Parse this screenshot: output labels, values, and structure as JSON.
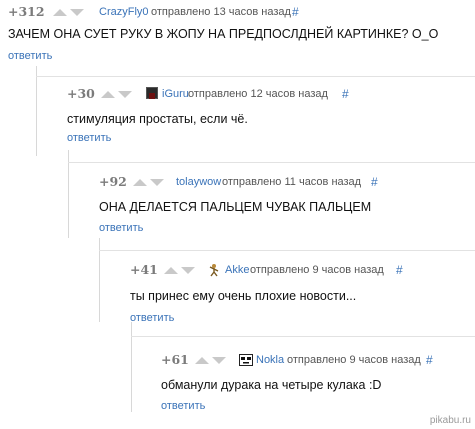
{
  "comments": [
    {
      "rating": "+312",
      "author": "CrazyFly0",
      "posted": "отправлено 13 часов назад",
      "hash": "#",
      "text": "ЗАЧЕМ ОНА СУЕТ РУКУ В ЖОПУ НА ПРЕДПОСЛДНЕЙ КАРТИНКЕ? О_О",
      "reply": "ответить",
      "avatar_icon": "none"
    },
    {
      "rating": "+30",
      "author": "iGuru",
      "posted": "отправлено 12 часов назад",
      "hash": "#",
      "text": "стимуляция простаты, если чё.",
      "reply": "ответить",
      "avatar_icon": "dark-avatar-icon"
    },
    {
      "rating": "+92",
      "author": "tolaywow",
      "posted": "отправлено 11 часов назад",
      "hash": "#",
      "text": "ОНА ДЕЛАЕТСЯ ПАЛЬЦЕМ ЧУВАК ПАЛЬЦЕМ",
      "reply": "ответить",
      "avatar_icon": "none"
    },
    {
      "rating": "+41",
      "author": "Akke",
      "posted": "отправлено 9 часов назад",
      "hash": "#",
      "text": "ты принес ему очень плохие новости...",
      "reply": "ответить",
      "avatar_icon": "figure-avatar-icon"
    },
    {
      "rating": "+61",
      "author": "Nokla",
      "posted": "отправлено 9 часов назад",
      "hash": "#",
      "text": "обманули дурака на четыре кулака :D",
      "reply": "ответить",
      "avatar_icon": "face-avatar-icon"
    }
  ],
  "watermark": "pikabu.ru",
  "colors": {
    "link": "#3a73b8",
    "rating": "#7b7b7b",
    "vote_arrow": "#c9c9c9",
    "branch_line": "#d8d8d8"
  }
}
